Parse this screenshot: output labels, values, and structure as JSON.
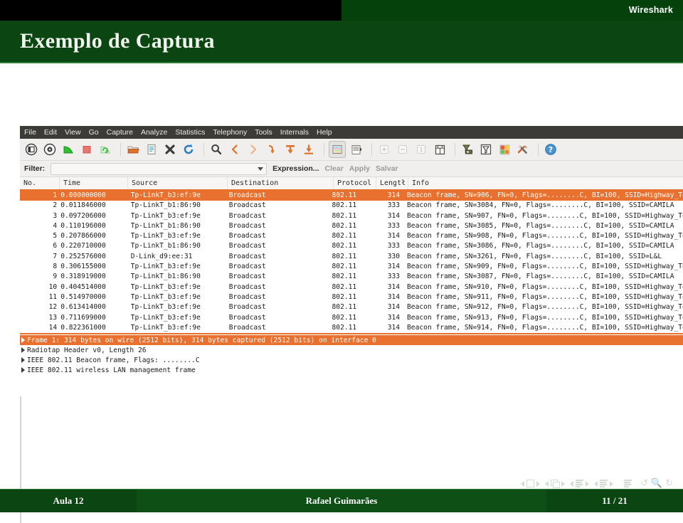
{
  "slide": {
    "tab_label": "Wireshark",
    "title": "Exemplo de Captura",
    "footer": {
      "left": "Aula 12",
      "center": "Rafael Guimarães",
      "right": "11 / 21"
    },
    "accent_green": "#0b4512",
    "accent_light_green": "#2c7a36"
  },
  "wireshark": {
    "menu": [
      "File",
      "Edit",
      "View",
      "Go",
      "Capture",
      "Analyze",
      "Statistics",
      "Telephony",
      "Tools",
      "Internals",
      "Help"
    ],
    "toolbar_icons": [
      "list-interfaces-icon",
      "capture-options-icon",
      "start-capture-icon",
      "stop-capture-icon",
      "restart-capture-icon",
      "open-file-icon",
      "save-file-icon",
      "close-file-icon",
      "reload-file-icon",
      "find-packet-icon",
      "go-back-icon",
      "go-forward-icon",
      "go-to-packet-icon",
      "go-to-first-packet-icon",
      "go-to-last-packet-icon",
      "colorize-icon",
      "auto-scroll-icon",
      "zoom-in-icon",
      "zoom-out-icon",
      "zoom-reset-icon",
      "resize-columns-icon",
      "capture-filters-icon",
      "display-filters-icon",
      "coloring-rules-icon",
      "preferences-icon",
      "help-icon"
    ],
    "filter": {
      "label": "Filter:",
      "value": "",
      "placeholder": "",
      "expression_label": "Expression...",
      "clear_label": "Clear",
      "apply_label": "Apply",
      "save_label": "Salvar"
    },
    "columns": [
      "No.",
      "Time",
      "Source",
      "Destination",
      "Protocol",
      "Lengtł",
      "Info"
    ],
    "selected_packet_index": 0,
    "selection_color": "#e8712f",
    "packets": [
      {
        "no": "1",
        "time": "0.000000000",
        "source": "Tp-LinkT_b3:ef:9e",
        "destination": "Broadcast",
        "protocol": "802.11",
        "length": "314",
        "info": "Beacon frame, SN=906, FN=0, Flags=........C, BI=100, SSID=Highway_To_Hell"
      },
      {
        "no": "2",
        "time": "0.011846000",
        "source": "Tp-LinkT_b1:86:90",
        "destination": "Broadcast",
        "protocol": "802.11",
        "length": "333",
        "info": "Beacon frame, SN=3084, FN=0, Flags=........C, BI=100, SSID=CAMILA"
      },
      {
        "no": "3",
        "time": "0.097206000",
        "source": "Tp-LinkT_b3:ef:9e",
        "destination": "Broadcast",
        "protocol": "802.11",
        "length": "314",
        "info": "Beacon frame, SN=907, FN=0, Flags=........C, BI=100, SSID=Highway_To_Hell"
      },
      {
        "no": "4",
        "time": "0.110196000",
        "source": "Tp-LinkT_b1:86:90",
        "destination": "Broadcast",
        "protocol": "802.11",
        "length": "333",
        "info": "Beacon frame, SN=3085, FN=0, Flags=........C, BI=100, SSID=CAMILA"
      },
      {
        "no": "5",
        "time": "0.207866000",
        "source": "Tp-LinkT_b3:ef:9e",
        "destination": "Broadcast",
        "protocol": "802.11",
        "length": "314",
        "info": "Beacon frame, SN=908, FN=0, Flags=........C, BI=100, SSID=Highway_To_Hell"
      },
      {
        "no": "6",
        "time": "0.220710000",
        "source": "Tp-LinkT_b1:86:90",
        "destination": "Broadcast",
        "protocol": "802.11",
        "length": "333",
        "info": "Beacon frame, SN=3086, FN=0, Flags=........C, BI=100, SSID=CAMILA"
      },
      {
        "no": "7",
        "time": "0.252576000",
        "source": "D-Link_d9:ee:31",
        "destination": "Broadcast",
        "protocol": "802.11",
        "length": "330",
        "info": "Beacon frame, SN=3261, FN=0, Flags=........C, BI=100, SSID=L&L"
      },
      {
        "no": "8",
        "time": "0.306155000",
        "source": "Tp-LinkT_b3:ef:9e",
        "destination": "Broadcast",
        "protocol": "802.11",
        "length": "314",
        "info": "Beacon frame, SN=909, FN=0, Flags=........C, BI=100, SSID=Highway_To_Hell"
      },
      {
        "no": "9",
        "time": "0.318919000",
        "source": "Tp-LinkT_b1:86:90",
        "destination": "Broadcast",
        "protocol": "802.11",
        "length": "333",
        "info": "Beacon frame, SN=3087, FN=0, Flags=........C, BI=100, SSID=CAMILA"
      },
      {
        "no": "10",
        "time": "0.404514000",
        "source": "Tp-LinkT_b3:ef:9e",
        "destination": "Broadcast",
        "protocol": "802.11",
        "length": "314",
        "info": "Beacon frame, SN=910, FN=0, Flags=........C, BI=100, SSID=Highway_To_Hell"
      },
      {
        "no": "11",
        "time": "0.514970000",
        "source": "Tp-LinkT_b3:ef:9e",
        "destination": "Broadcast",
        "protocol": "802.11",
        "length": "314",
        "info": "Beacon frame, SN=911, FN=0, Flags=........C, BI=100, SSID=Highway_To_Hell"
      },
      {
        "no": "12",
        "time": "0.613414000",
        "source": "Tp-LinkT_b3:ef:9e",
        "destination": "Broadcast",
        "protocol": "802.11",
        "length": "314",
        "info": "Beacon frame, SN=912, FN=0, Flags=........C, BI=100, SSID=Highway_To_Hell"
      },
      {
        "no": "13",
        "time": "0.711699000",
        "source": "Tp-LinkT_b3:ef:9e",
        "destination": "Broadcast",
        "protocol": "802.11",
        "length": "314",
        "info": "Beacon frame, SN=913, FN=0, Flags=........C, BI=100, SSID=Highway_To_Hell"
      },
      {
        "no": "14",
        "time": "0.822361000",
        "source": "Tp-LinkT_b3:ef:9e",
        "destination": "Broadcast",
        "protocol": "802.11",
        "length": "314",
        "info": "Beacon frame, SN=914, FN=0, Flags=........C, BI=100, SSID=Highway_To_Hell"
      }
    ],
    "detail_tree": [
      {
        "label": "Frame 1: 314 bytes on wire (2512 bits), 314 bytes captured (2512 bits) on interface 0",
        "selected": true
      },
      {
        "label": "Radiotap Header v0, Length 26",
        "selected": false
      },
      {
        "label": "IEEE 802.11 Beacon frame, Flags: ........C",
        "selected": false
      },
      {
        "label": "IEEE 802.11 wireless LAN management frame",
        "selected": false
      }
    ]
  },
  "navigation": {
    "icons": [
      "prev-frame-icon",
      "frame-icon",
      "next-frame-icon",
      "prev-subsection-icon",
      "slides-icon",
      "next-subsection-icon",
      "prev-section-icon",
      "section-lines-icon",
      "next-section-icon",
      "prev-doc-icon",
      "doc-lines-icon",
      "next-doc-icon",
      "all-lines-icon",
      "back-icon",
      "search-icon",
      "forward-icon"
    ]
  }
}
